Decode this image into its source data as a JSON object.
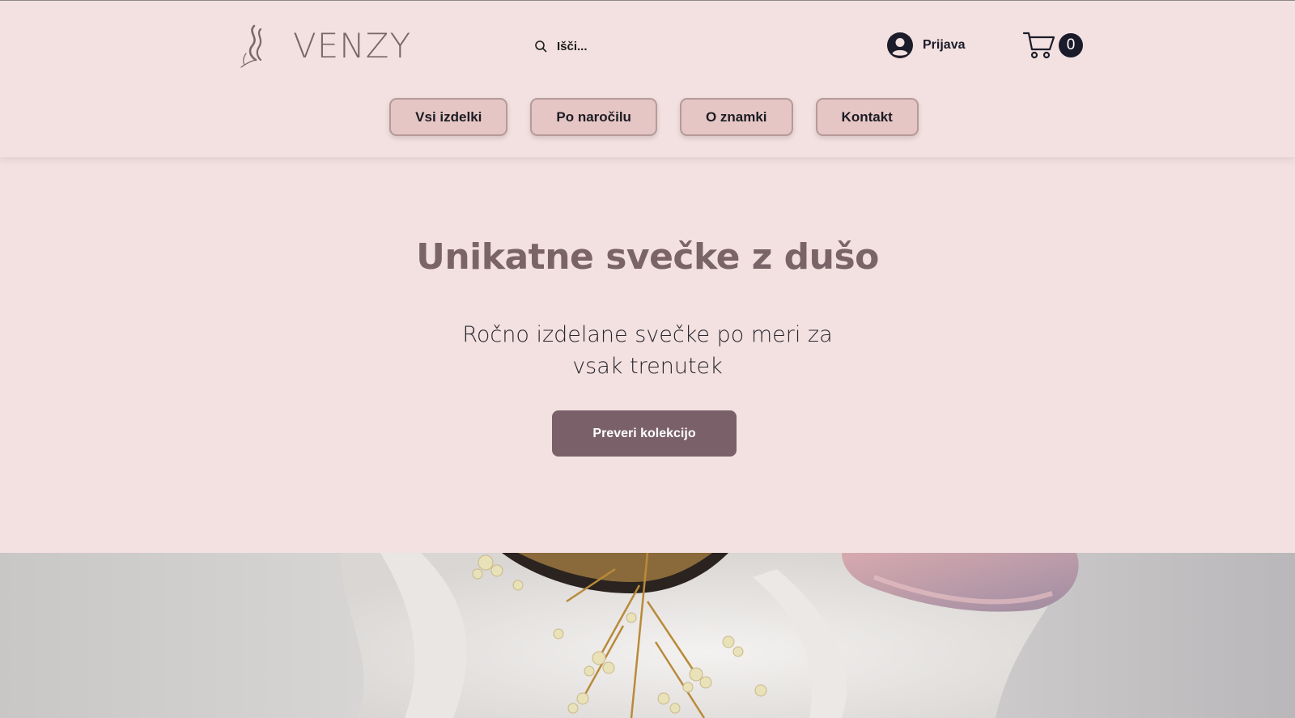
{
  "brand": {
    "name": "VENZY",
    "logo_icon": "flame-icon",
    "color": "#7a6769"
  },
  "search": {
    "placeholder": "Išči...",
    "icon": "search-icon"
  },
  "account": {
    "login_label": "Prijava",
    "icon": "user-avatar-icon"
  },
  "cart": {
    "icon": "cart-icon",
    "count": "0"
  },
  "nav": {
    "items": [
      {
        "label": "Vsi izdelki"
      },
      {
        "label": "Po naročilu"
      },
      {
        "label": "O znamki"
      },
      {
        "label": "Kontakt"
      }
    ]
  },
  "hero": {
    "title": "Unikatne svečke z dušo",
    "subtitle": "Ročno izdelane svečke po meri za vsak trenutek",
    "cta_label": "Preveri kolekcijo"
  },
  "colors": {
    "background": "#f2e1e0",
    "nav_button": "#e5c6c4",
    "cta": "#7a6169",
    "title": "#7b6468"
  }
}
